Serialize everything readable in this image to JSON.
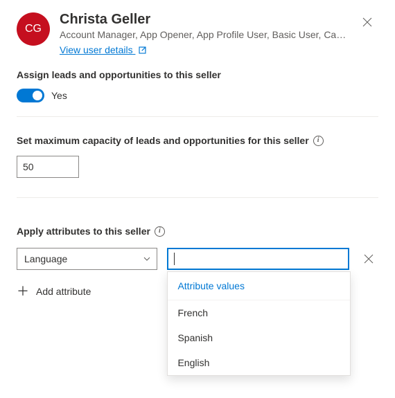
{
  "header": {
    "initials": "CG",
    "name": "Christa Geller",
    "subtitle": "Account Manager, App Opener, App Profile User, Basic User, Car...",
    "link_label": "View user details"
  },
  "assign": {
    "label": "Assign leads and opportunities to this seller",
    "toggle_text": "Yes"
  },
  "capacity": {
    "label": "Set maximum capacity of leads and opportunities for this seller",
    "value": "50"
  },
  "attributes": {
    "label": "Apply attributes to this seller",
    "selected_key": "Language",
    "combo_value": "",
    "dropdown_header": "Attribute values",
    "options": [
      "French",
      "Spanish",
      "English"
    ],
    "add_label": "Add attribute"
  }
}
